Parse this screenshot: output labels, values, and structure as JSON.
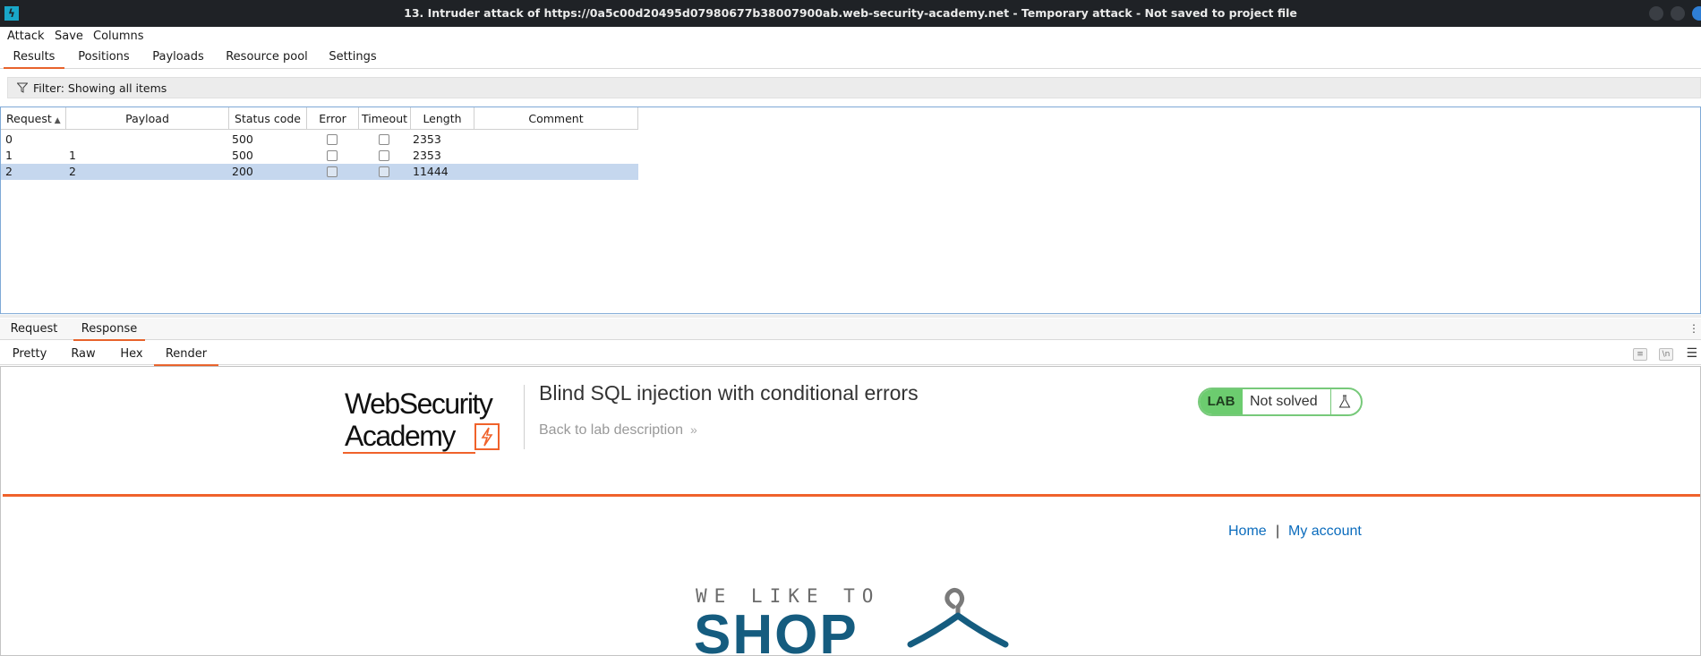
{
  "window": {
    "title": "13. Intruder attack of https://0a5c00d20495d07980677b38007900ab.web-security-academy.net - Temporary attack - Not saved to project file"
  },
  "menu": [
    "Attack",
    "Save",
    "Columns"
  ],
  "tabs": [
    "Results",
    "Positions",
    "Payloads",
    "Resource pool",
    "Settings"
  ],
  "active_tab": "Results",
  "filter": {
    "label": "Filter: Showing all items"
  },
  "table": {
    "columns": [
      "Request",
      "Payload",
      "Status code",
      "Error",
      "Timeout",
      "Length",
      "Comment"
    ],
    "sorted_by": "Request",
    "rows": [
      {
        "request": "0",
        "payload": "",
        "status": "500",
        "error": false,
        "timeout": false,
        "length": "2353",
        "comment": "",
        "selected": false
      },
      {
        "request": "1",
        "payload": "1",
        "status": "500",
        "error": false,
        "timeout": false,
        "length": "2353",
        "comment": "",
        "selected": false
      },
      {
        "request": "2",
        "payload": "2",
        "status": "200",
        "error": false,
        "timeout": false,
        "length": "11444",
        "comment": "",
        "selected": true
      }
    ]
  },
  "message_tabs": [
    "Request",
    "Response"
  ],
  "active_message_tab": "Response",
  "view_tabs": [
    "Pretty",
    "Raw",
    "Hex",
    "Render"
  ],
  "active_view_tab": "Render",
  "render": {
    "logo": {
      "line1": "WebSecurity",
      "line2": "Academy"
    },
    "lab_title": "Blind SQL injection with conditional errors",
    "back_link": "Back to lab description",
    "lab_badge": {
      "tag": "LAB",
      "status": "Not solved"
    },
    "nav": {
      "home": "Home",
      "separator": "|",
      "account": "My account"
    },
    "shop_tagline": "WE LIKE TO",
    "shop_word": "SHOP"
  },
  "colors": {
    "accent": "#e8632c",
    "selection": "#c5d7ee",
    "lab_green": "#6ccc6f",
    "link": "#0b6cbd",
    "shop_blue": "#155c7f"
  }
}
